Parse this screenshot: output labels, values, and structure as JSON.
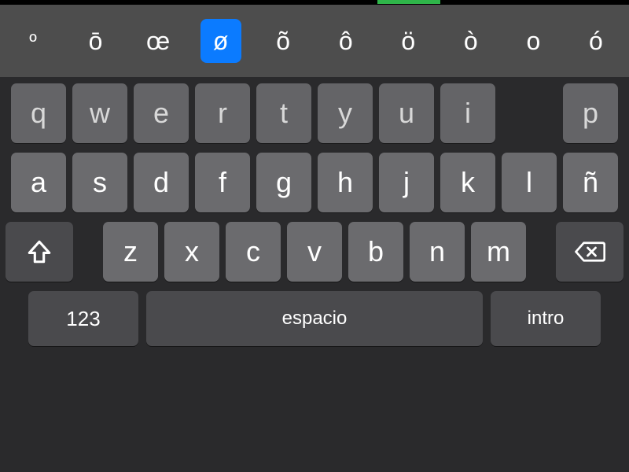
{
  "accents": {
    "options": [
      "º",
      "ō",
      "œ",
      "ø",
      "õ",
      "ô",
      "ö",
      "ò",
      "o",
      "ó"
    ],
    "selected_index": 3
  },
  "rows": {
    "r1": [
      "q",
      "w",
      "e",
      "r",
      "t",
      "y",
      "u",
      "i",
      "",
      "p"
    ],
    "r2": [
      "a",
      "s",
      "d",
      "f",
      "g",
      "h",
      "j",
      "k",
      "l",
      "ñ"
    ],
    "r3": [
      "z",
      "x",
      "c",
      "v",
      "b",
      "n",
      "m"
    ]
  },
  "fn": {
    "numbers": "123",
    "space": "espacio",
    "enter": "intro"
  }
}
